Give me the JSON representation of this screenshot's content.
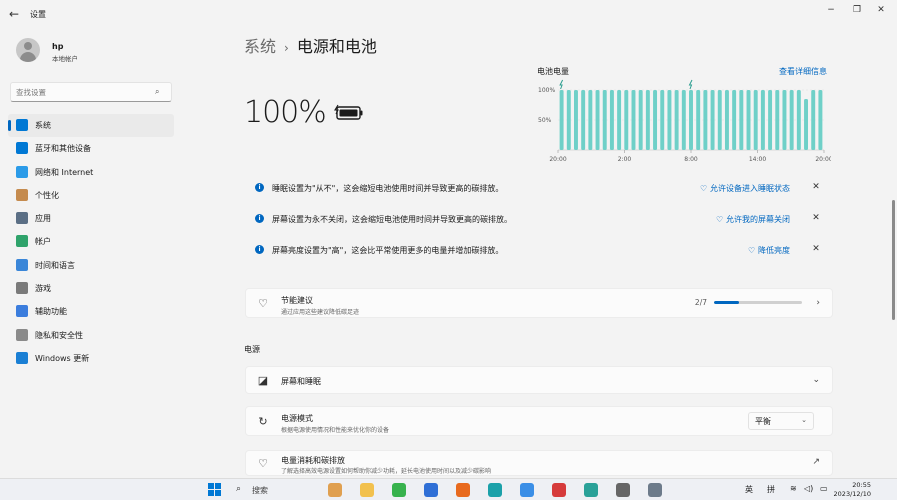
{
  "window": {
    "title": "设置",
    "back_icon": "back-arrow-icon",
    "controls": [
      "minimize-icon",
      "restore-icon",
      "close-icon"
    ]
  },
  "user": {
    "name": "hp",
    "account_type": "本地帐户"
  },
  "search": {
    "placeholder": "查找设置"
  },
  "sidebar": {
    "items": [
      {
        "label": "系统",
        "icon": "system-icon",
        "color": "#0078d4",
        "active": true
      },
      {
        "label": "蓝牙和其他设备",
        "icon": "bluetooth-icon",
        "color": "#0078d4",
        "active": false
      },
      {
        "label": "网络和 Internet",
        "icon": "wifi-icon",
        "color": "#2b9be8",
        "active": false
      },
      {
        "label": "个性化",
        "icon": "brush-icon",
        "color": "#c58b4e",
        "active": false
      },
      {
        "label": "应用",
        "icon": "apps-icon",
        "color": "#5b6f85",
        "active": false
      },
      {
        "label": "帐户",
        "icon": "account-icon",
        "color": "#2fa36b",
        "active": false
      },
      {
        "label": "时间和语言",
        "icon": "globe-clock-icon",
        "color": "#3a86d8",
        "active": false
      },
      {
        "label": "游戏",
        "icon": "gamepad-icon",
        "color": "#7a7a7a",
        "active": false
      },
      {
        "label": "辅助功能",
        "icon": "accessibility-icon",
        "color": "#3b7ddd",
        "active": false
      },
      {
        "label": "隐私和安全性",
        "icon": "shield-icon",
        "color": "#8a8a8a",
        "active": false
      },
      {
        "label": "Windows 更新",
        "icon": "update-icon",
        "color": "#1a7fd4",
        "active": false
      }
    ]
  },
  "breadcrumb": {
    "parent": "系统",
    "separator": "›",
    "current": "电源和电池"
  },
  "battery": {
    "percent": "100%",
    "icon": "battery-charging-icon",
    "level": 1.0
  },
  "chart_data": {
    "type": "bar",
    "title": "电池电量",
    "link": "查看详细信息",
    "y_ticks": [
      "100%",
      "50%"
    ],
    "x_ticks": [
      "20:00",
      "2:00",
      "8:00",
      "14:00",
      "20:00"
    ],
    "ylim": [
      0,
      100
    ],
    "color": "#6fd0c8",
    "values": [
      100,
      100,
      100,
      100,
      100,
      100,
      100,
      100,
      100,
      100,
      100,
      100,
      100,
      100,
      100,
      100,
      100,
      100,
      100,
      100,
      100,
      100,
      100,
      100,
      100,
      100,
      100,
      100,
      100,
      100,
      100,
      100,
      100,
      100,
      85,
      100,
      100
    ],
    "charging_markers": [
      0,
      18
    ]
  },
  "notices": [
    {
      "text": "睡眠设置为\"从不\"，这会缩短电池使用时间并导致更高的碳排放。",
      "action": "允许设备进入睡眠状态",
      "action_icon": "leaf-icon"
    },
    {
      "text": "屏幕设置为永不关闭，这会缩短电池使用时间并导致更高的碳排放。",
      "action": "允许我的屏幕关闭",
      "action_icon": "leaf-icon"
    },
    {
      "text": "屏幕亮度设置为\"高\"，这会比平常使用更多的电量并增加碳排放。",
      "action": "降低亮度",
      "action_icon": "leaf-icon"
    }
  ],
  "energy_tips": {
    "title": "节能建议",
    "subtitle": "通过应用这些建议降低碳足迹",
    "progress_label": "2/7",
    "progress": 0.286
  },
  "power_section": {
    "title": "电源",
    "screen_sleep": {
      "title": "屏幕和睡眠"
    },
    "power_mode": {
      "title": "电源模式",
      "subtitle": "根据电源使用情况和性能来优化你的设备",
      "value": "平衡"
    },
    "usage": {
      "title": "电量消耗和碳排放",
      "subtitle": "了解选择高效电源设置如何帮助你减少功耗，延长电池使用时间以及减少碳影响"
    }
  },
  "taskbar": {
    "search_label": "搜索",
    "tray": {
      "ime_lang": "英",
      "ime_mode": "拼"
    },
    "clock": {
      "time": "20:55",
      "date": "2023/12/10"
    },
    "apps": [
      {
        "name": "widgets-icon",
        "color": "#e0a050"
      },
      {
        "name": "file-explorer-icon",
        "color": "#f2c14e"
      },
      {
        "name": "app-green-icon",
        "color": "#37b24d"
      },
      {
        "name": "app-blue-icon",
        "color": "#2f6fd6"
      },
      {
        "name": "app-orange-icon",
        "color": "#e86a1e"
      },
      {
        "name": "edge-icon",
        "color": "#1ba1a9"
      },
      {
        "name": "store-icon",
        "color": "#3a8ee6"
      },
      {
        "name": "app-red-icon",
        "color": "#d63b3b"
      },
      {
        "name": "app-teal-icon",
        "color": "#2aa198"
      },
      {
        "name": "app-gray-icon",
        "color": "#666666"
      },
      {
        "name": "settings-gear-icon",
        "color": "#6d7b8a"
      }
    ]
  }
}
